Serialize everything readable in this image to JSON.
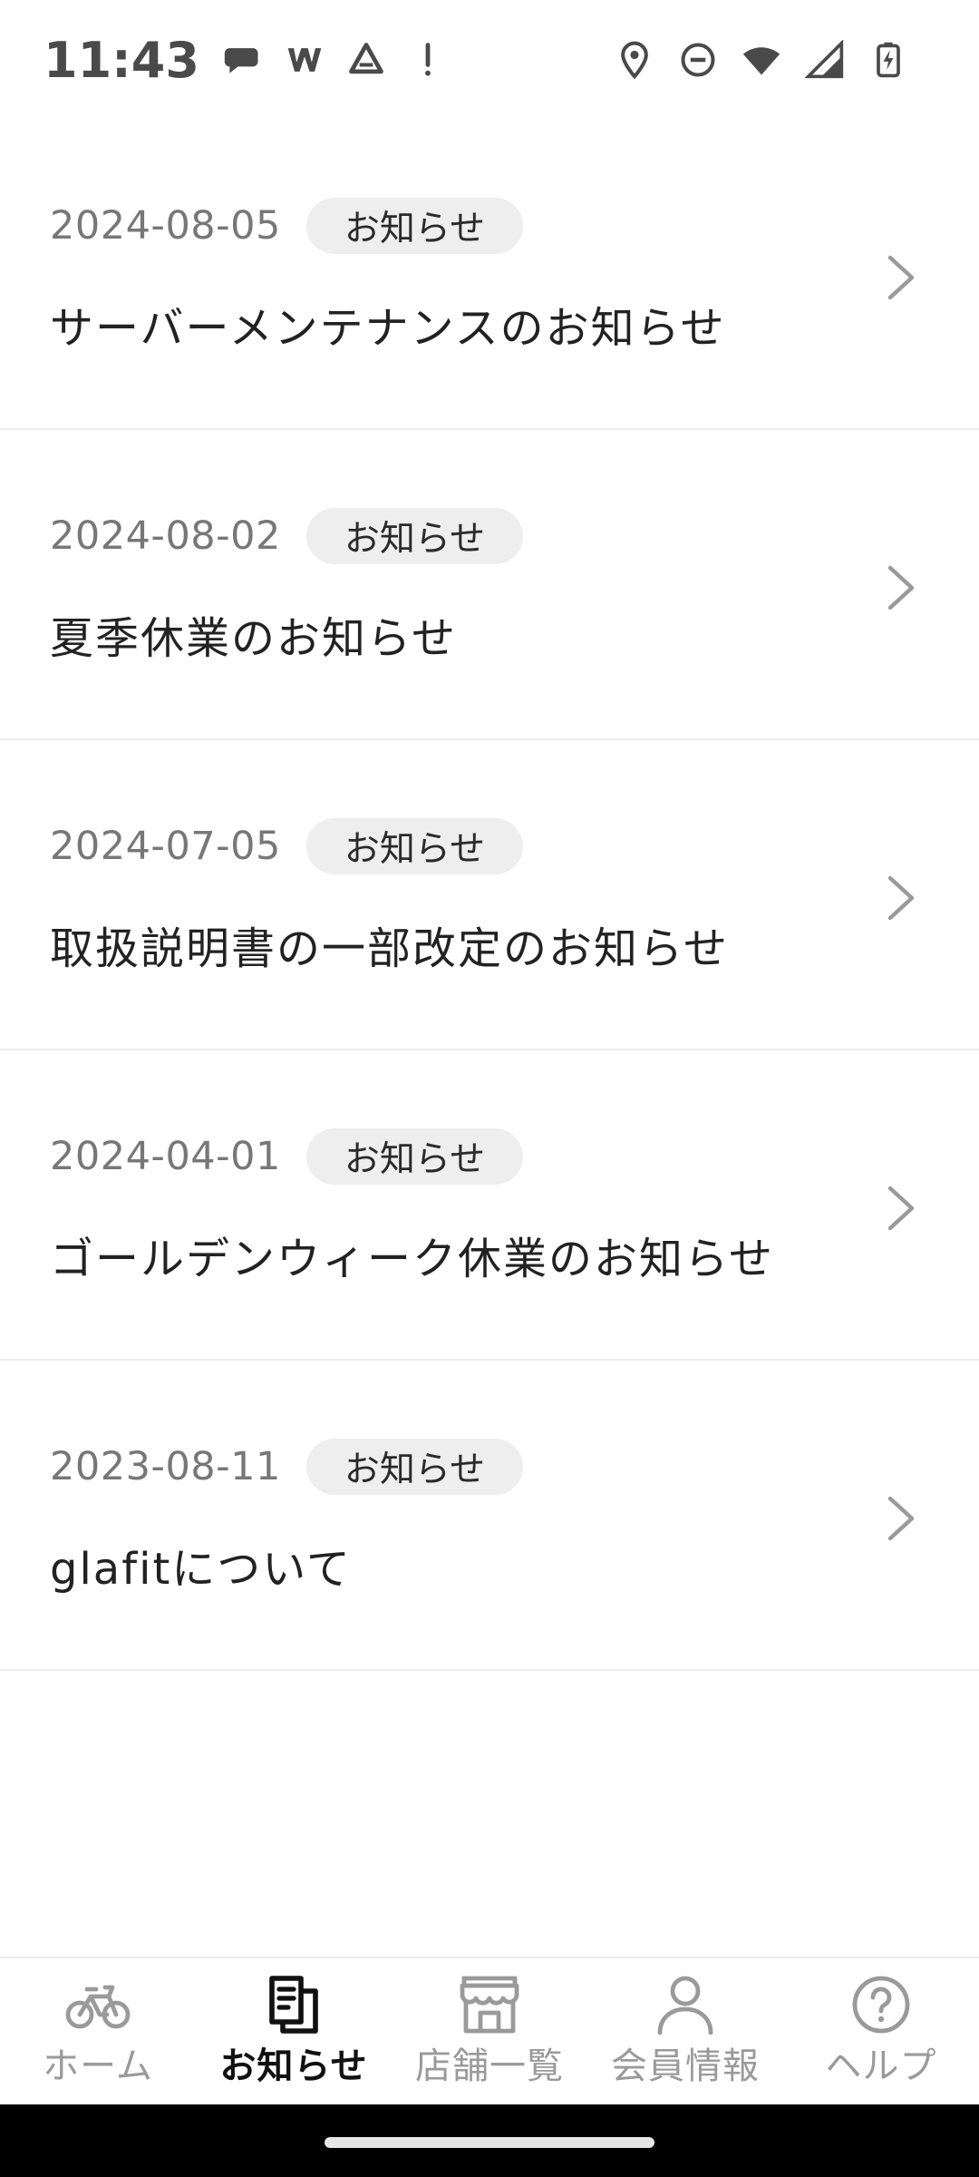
{
  "status_bar": {
    "time": "11:43"
  },
  "news": {
    "items": [
      {
        "date": "2024-08-05",
        "tag": "お知らせ",
        "title": "サーバーメンテナンスのお知らせ"
      },
      {
        "date": "2024-08-02",
        "tag": "お知らせ",
        "title": "夏季休業のお知らせ"
      },
      {
        "date": "2024-07-05",
        "tag": "お知らせ",
        "title": "取扱説明書の一部改定のお知らせ"
      },
      {
        "date": "2024-04-01",
        "tag": "お知らせ",
        "title": "ゴールデンウィーク休業のお知らせ"
      },
      {
        "date": "2023-08-11",
        "tag": "お知らせ",
        "title": "glafitについて"
      }
    ]
  },
  "bottom_nav": {
    "items": [
      {
        "label": "ホーム",
        "icon": "bicycle-icon"
      },
      {
        "label": "お知らせ",
        "icon": "news-icon",
        "active": true
      },
      {
        "label": "店舗一覧",
        "icon": "store-icon"
      },
      {
        "label": "会員情報",
        "icon": "person-icon"
      },
      {
        "label": "ヘルプ",
        "icon": "help-icon"
      }
    ]
  },
  "colors": {
    "active": "#111111",
    "inactive": "#9a9a9a",
    "tag_bg": "#eeeeee",
    "divider": "#ececec"
  }
}
